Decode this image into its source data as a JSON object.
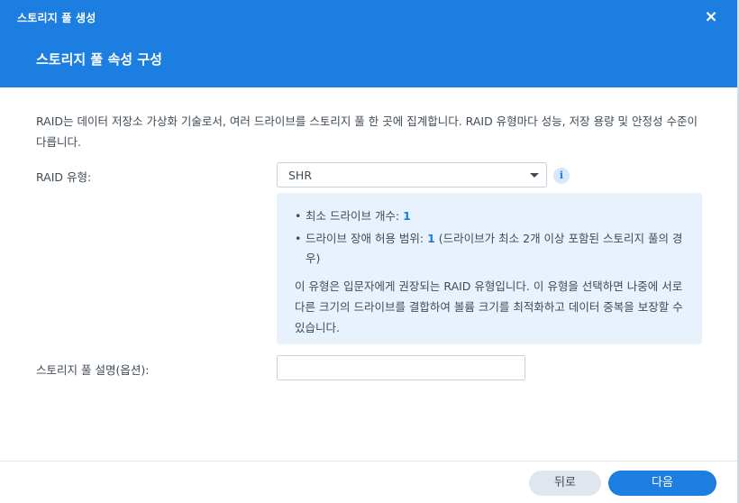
{
  "window": {
    "title": "스토리지 풀 생성",
    "close_icon": "×"
  },
  "step_title": "스토리지 풀 속성 구성",
  "description": "RAID는 데이터 저장소 가상화 기술로서, 여러 드라이브를 스토리지 풀 한 곳에 집계합니다. RAID 유형마다 성능, 저장 용량 및 안정성 수준이 다릅니다.",
  "raid_type": {
    "label": "RAID 유형:",
    "selected": "SHR",
    "info_icon": "i"
  },
  "info_box": {
    "min_drives_label": "최소 드라이브 개수: ",
    "min_drives_value": "1",
    "fault_tolerance_label": "드라이브 장애 허용 범위: ",
    "fault_tolerance_value": "1",
    "fault_tolerance_note": " (드라이브가 최소 2개 이상 포함된 스토리지 풀의 경우)",
    "paragraph": "이 유형은 입문자에게 권장되는 RAID 유형입니다. 이 유형을 선택하면 나중에 서로 다른 크기의 드라이브를 결합하여 볼륨 크기를 최적화하고 데이터 중복을 보장할 수 있습니다."
  },
  "pool_description": {
    "label": "스토리지 풀 설명(옵션):",
    "value": "",
    "placeholder": ""
  },
  "buttons": {
    "back": "뒤로",
    "next": "다음"
  },
  "colors": {
    "accent": "#1b7ee0",
    "info_background": "#e8f2fc"
  }
}
